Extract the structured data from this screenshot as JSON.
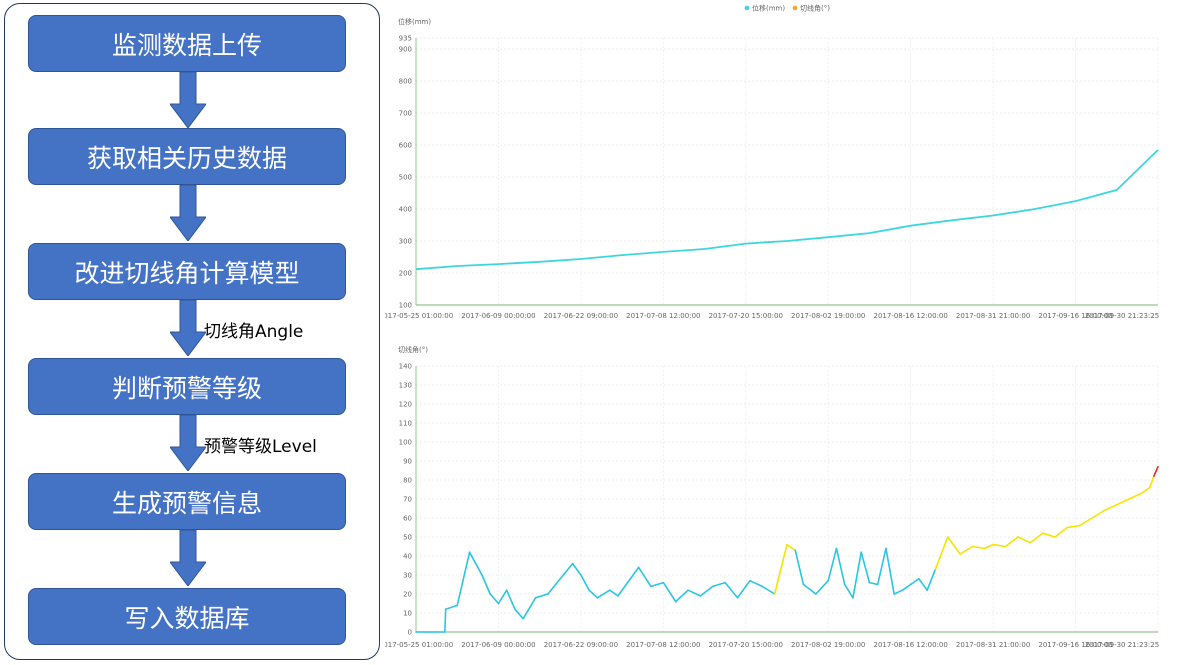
{
  "flowchart": {
    "steps": [
      "监测数据上传",
      "获取相关历史数据",
      "改进切线角计算模型",
      "判断预警等级",
      "生成预警信息",
      "写入数据库"
    ],
    "edge_labels": [
      "",
      "",
      "切线角Angle",
      "预警等级Level",
      ""
    ],
    "colors": {
      "box_fill": "#4472c4",
      "box_border": "#2f5597",
      "frame": "#1f3864"
    }
  },
  "chart_data": [
    {
      "type": "line",
      "legend": [
        "位移(mm)",
        "切线角(°)"
      ],
      "legend_colors": [
        "#3dd6dd",
        "#f5a623"
      ],
      "ylabel": "位移(mm)",
      "ylim": [
        100,
        935
      ],
      "yticks": [
        100,
        200,
        300,
        400,
        500,
        600,
        700,
        800,
        900,
        935
      ],
      "xticks": [
        "2017-05-25 01:00:00",
        "2017-06-09 00:00:00",
        "2017-06-22 09:00:00",
        "2017-07-08 12:00:00",
        "2017-07-20 15:00:00",
        "2017-08-02 19:00:00",
        "2017-08-16 12:00:00",
        "2017-08-31 21:00:00",
        "2017-09-16 16:00:00",
        "2017-09-30 21:23:25"
      ],
      "grid": true,
      "series": [
        {
          "name": "位移(mm)",
          "color": "#3dd6dd",
          "x": [
            0,
            0.5,
            1,
            1.5,
            2,
            2.5,
            3,
            3.5,
            4,
            4.5,
            5,
            5.5,
            6,
            6.5,
            7,
            7.5,
            8,
            8.5,
            9
          ],
          "values": [
            212,
            222,
            228,
            235,
            244,
            256,
            266,
            275,
            292,
            300,
            312,
            325,
            348,
            365,
            380,
            400,
            425,
            460,
            585
          ]
        }
      ]
    },
    {
      "type": "line",
      "ylabel": "切线角(°)",
      "ylim": [
        0,
        140
      ],
      "yticks": [
        0,
        10,
        20,
        30,
        40,
        50,
        60,
        70,
        80,
        90,
        100,
        110,
        120,
        130,
        140
      ],
      "xticks": [
        "2017-05-25 01:00:00",
        "2017-06-09 00:00:00",
        "2017-06-22 09:00:00",
        "2017-07-08 12:00:00",
        "2017-07-20 15:00:00",
        "2017-08-02 19:00:00",
        "2017-08-16 12:00:00",
        "2017-08-31 21:00:00",
        "2017-09-16 16:00:00",
        "2017-09-30 21:23:25"
      ],
      "grid": true,
      "color_thresholds": {
        "below_45": "#29c5e3",
        "45_to_85": "#f5e400",
        "above_85": "#e8291c"
      },
      "series": [
        {
          "name": "切线角(°)",
          "x": [
            0,
            0.35,
            0.36,
            0.5,
            0.65,
            0.8,
            0.9,
            1.0,
            1.1,
            1.2,
            1.3,
            1.45,
            1.6,
            1.75,
            1.9,
            2.0,
            2.1,
            2.2,
            2.35,
            2.45,
            2.55,
            2.7,
            2.85,
            3.0,
            3.15,
            3.3,
            3.45,
            3.6,
            3.75,
            3.9,
            4.05,
            4.2,
            4.35,
            4.5,
            4.6,
            4.7,
            4.85,
            5.0,
            5.1,
            5.2,
            5.3,
            5.4,
            5.5,
            5.6,
            5.7,
            5.8,
            5.9,
            6.0,
            6.1,
            6.2,
            6.3,
            6.45,
            6.6,
            6.75,
            6.9,
            7.0,
            7.15,
            7.3,
            7.45,
            7.6,
            7.75,
            7.9,
            8.05,
            8.2,
            8.35,
            8.5,
            8.65,
            8.8,
            8.9,
            8.95,
            9.0
          ],
          "values": [
            0,
            0,
            12,
            14,
            42,
            30,
            20,
            15,
            22,
            12,
            7,
            18,
            20,
            28,
            36,
            30,
            22,
            18,
            22,
            19,
            25,
            34,
            24,
            26,
            16,
            22,
            19,
            24,
            26,
            18,
            27,
            24,
            20,
            46,
            43,
            25,
            20,
            27,
            44,
            25,
            18,
            42,
            26,
            25,
            44,
            20,
            22,
            25,
            28,
            22,
            33,
            50,
            41,
            45,
            44,
            46,
            45,
            50,
            47,
            52,
            50,
            55,
            56,
            60,
            64,
            67,
            70,
            73,
            76,
            82,
            87
          ]
        }
      ]
    }
  ]
}
